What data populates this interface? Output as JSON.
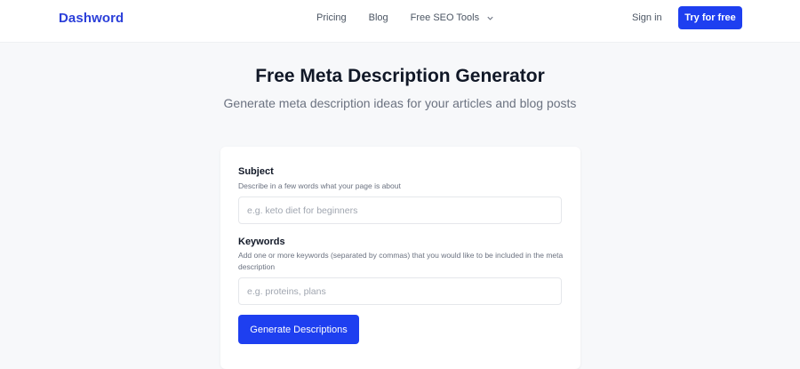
{
  "nav": {
    "logo": "Dashword",
    "links": [
      {
        "label": "Pricing"
      },
      {
        "label": "Blog"
      },
      {
        "label": "Free SEO Tools",
        "icon": "chevron-down-icon"
      }
    ],
    "signin_label": "Sign in",
    "cta_label": "Try for free"
  },
  "hero": {
    "title": "Free Meta Description Generator",
    "subtitle": "Generate meta description ideas for your articles and blog posts"
  },
  "form": {
    "subject": {
      "label": "Subject",
      "help": "Describe in a few words what your page is about",
      "placeholder": "e.g. keto diet for beginners",
      "value": ""
    },
    "keywords": {
      "label": "Keywords",
      "help": "Add one or more keywords (separated by commas) that you would like to be included in the meta description",
      "placeholder": "e.g. proteins, plans",
      "value": ""
    },
    "submit_label": "Generate Descriptions"
  },
  "colors": {
    "brand": "#2b3fd9",
    "button": "#1e3ff0",
    "background": "#f7f8fa"
  }
}
